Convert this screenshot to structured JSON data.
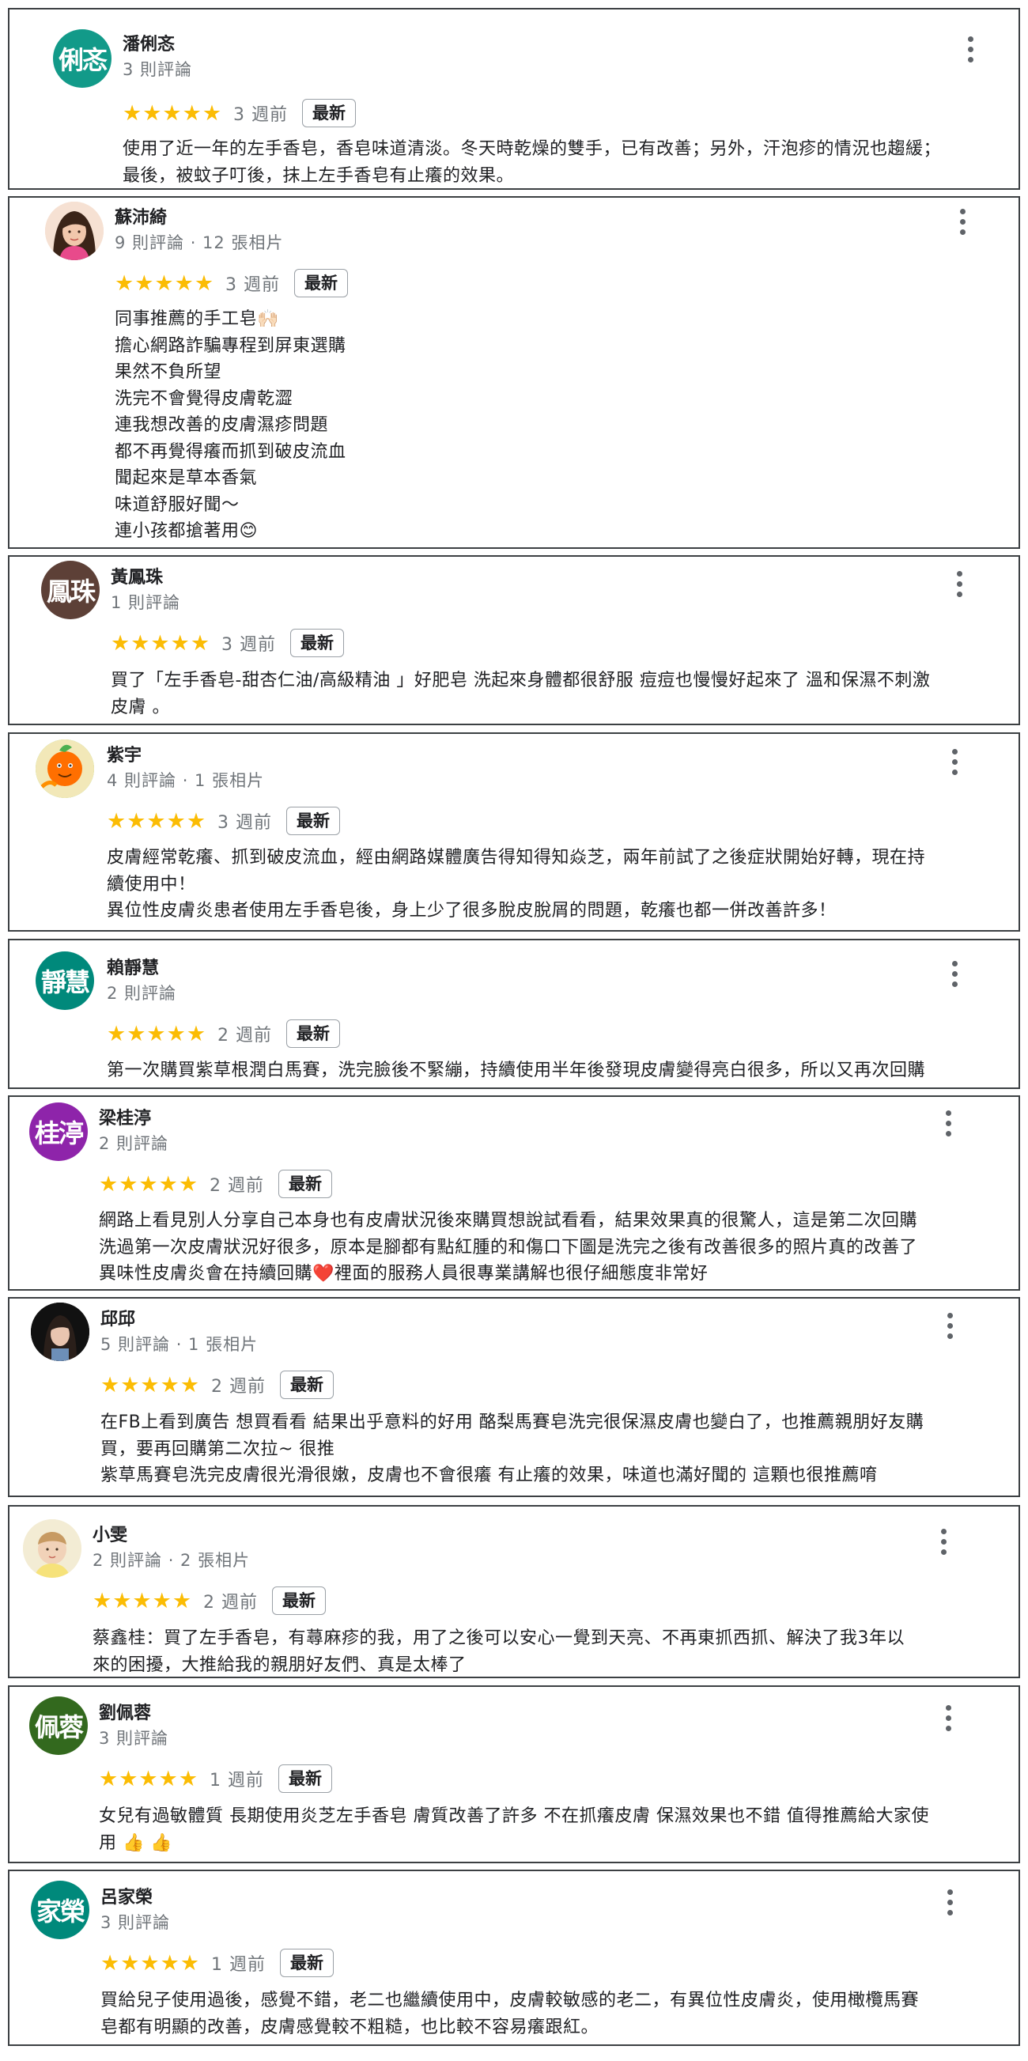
{
  "reviews": [
    {
      "name": "潘俐忞",
      "avatar_text": "俐忞",
      "avatar_color": "#129a89",
      "meta": "3 則評論",
      "stars": "★★★★★",
      "date": "3 週前",
      "badge": "最新",
      "text": "使用了近一年的左手香皂，香皂味道清淡。冬天時乾燥的雙手，已有改善；另外，汗泡疹的情況也趨緩；\n最後，被蚊子叮後，抹上左手香皂有止癢的效果。"
    },
    {
      "name": "蘇沛綺",
      "avatar_photo": "woman-portrait",
      "meta": "9 則評論 · 12 張相片",
      "stars": "★★★★★",
      "date": "3 週前",
      "badge": "最新",
      "text": "同事推薦的手工皂🙌🏻\n擔心網路詐騙專程到屏東選購\n果然不負所望\n洗完不會覺得皮膚乾澀\n連我想改善的皮膚濕疹問題\n都不再覺得癢而抓到破皮流血\n聞起來是草本香氣\n味道舒服好聞～\n連小孩都搶著用😊"
    },
    {
      "name": "黃鳳珠",
      "avatar_text": "鳳珠",
      "avatar_color": "#5d4037",
      "meta": "1 則評論",
      "stars": "★★★★★",
      "date": "3 週前",
      "badge": "最新",
      "text": "買了「左手香皂-甜杏仁油/高級精油 」好肥皂 洗起來身體都很舒服 痘痘也慢慢好起來了 溫和保濕不刺激\n皮膚 。"
    },
    {
      "name": "紫宇",
      "avatar_photo": "cartoon-orange",
      "meta": "4 則評論 · 1 張相片",
      "stars": "★★★★★",
      "date": "3 週前",
      "badge": "最新",
      "text": "皮膚經常乾癢、抓到破皮流血，經由網路媒體廣告得知得知焱芝，兩年前試了之後症狀開始好轉，現在持\n續使用中！\n異位性皮膚炎患者使用左手香皂後，身上少了很多脫皮脫屑的問題，乾癢也都一併改善許多！"
    },
    {
      "name": "賴靜慧",
      "avatar_text": "靜慧",
      "avatar_color": "#00897b",
      "meta": "2 則評論",
      "stars": "★★★★★",
      "date": "2 週前",
      "badge": "最新",
      "text": "第一次購買紫草根潤白馬賽，洗完臉後不緊繃，持續使用半年後發現皮膚變得亮白很多，所以又再次回購"
    },
    {
      "name": "梁桂渟",
      "avatar_text": "桂渟",
      "avatar_color": "#8e24aa",
      "meta": "2 則評論",
      "stars": "★★★★★",
      "date": "2 週前",
      "badge": "最新",
      "text": "網路上看見別人分享自己本身也有皮膚狀況後來購買想說試看看，結果效果真的很驚人，這是第二次回購\n洗過第一次皮膚狀況好很多，原本是腳都有點紅腫的和傷口下圖是洗完之後有改善很多的照片真的改善了\n異味性皮膚炎會在持續回購❤️裡面的服務人員很專業講解也很仔細態度非常好"
    },
    {
      "name": "邱邱",
      "avatar_photo": "person-dark",
      "meta": "5 則評論 · 1 張相片",
      "stars": "★★★★★",
      "date": "2 週前",
      "badge": "最新",
      "text": "在FB上看到廣告 想買看看 結果出乎意料的好用 酪梨馬賽皂洗完很保濕皮膚也變白了，也推薦親朋好友購\n買，要再回購第二次拉~ 很推\n紫草馬賽皂洗完皮膚很光滑很嫩，皮膚也不會很癢 有止癢的效果，味道也滿好聞的 這顆也很推薦唷"
    },
    {
      "name": "小雯",
      "avatar_photo": "baby-photo",
      "meta": "2 則評論 · 2 張相片",
      "stars": "★★★★★",
      "date": "2 週前",
      "badge": "最新",
      "text": "蔡鑫桂：買了左手香皂，有蕁麻疹的我，用了之後可以安心一覺到天亮、不再東抓西抓、解決了我3年以\n來的困擾，大推給我的親朋好友們、真是太棒了"
    },
    {
      "name": "劉佩蓉",
      "avatar_text": "佩蓉",
      "avatar_color": "#33691e",
      "meta": "3 則評論",
      "stars": "★★★★★",
      "date": "1 週前",
      "badge": "最新",
      "text": "女兒有過敏體質 長期使用炎芝左手香皂 膚質改善了許多 不在抓癢皮膚 保濕效果也不錯 值得推薦給大家使\n用 👍 👍"
    },
    {
      "name": "呂家榮",
      "avatar_text": "家榮",
      "avatar_color": "#00897b",
      "meta": "3 則評論",
      "stars": "★★★★★",
      "date": "1 週前",
      "badge": "最新",
      "text": "買給兒子使用過後，感覺不錯，老二也繼續使用中，皮膚較敏感的老二，有異位性皮膚炎，使用橄欖馬賽\n皂都有明顯的改善，皮膚感覺較不粗糙，也比較不容易癢跟紅。"
    }
  ]
}
